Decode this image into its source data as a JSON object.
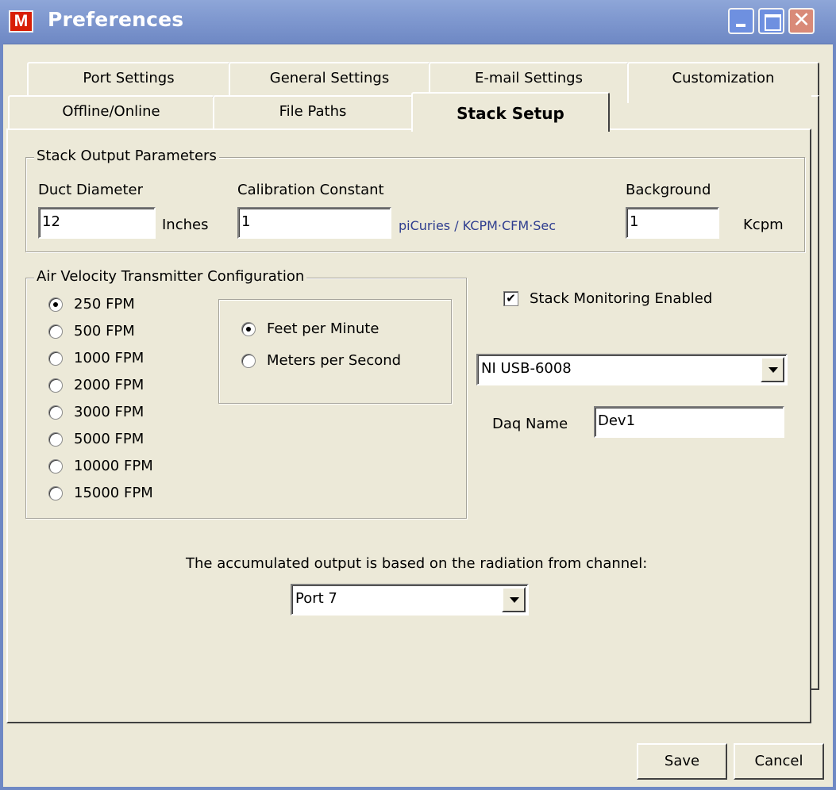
{
  "window": {
    "title": "Preferences",
    "icon_letter": "M",
    "close_glyph": "✕"
  },
  "tabs_back": [
    "Port Settings",
    "General Settings",
    "E-mail Settings",
    "Customization"
  ],
  "tabs_front": [
    "Offline/Online",
    "File Paths",
    "Stack Setup"
  ],
  "active_tab": "Stack Setup",
  "stack_output": {
    "title": "Stack Output Parameters",
    "duct_label": "Duct Diameter",
    "duct_value": "12",
    "duct_unit": "Inches",
    "cal_label": "Calibration Constant",
    "cal_value": "1",
    "cal_unit": "piCuries / KCPM·CFM·Sec",
    "bg_label": "Background",
    "bg_value": "1",
    "bg_unit": "Kcpm"
  },
  "air_velocity": {
    "title": "Air Velocity Transmitter Configuration",
    "options": [
      "250 FPM",
      "500 FPM",
      "1000 FPM",
      "2000 FPM",
      "3000 FPM",
      "5000 FPM",
      "10000 FPM",
      "15000 FPM"
    ],
    "selected": "250 FPM",
    "units": [
      "Feet per Minute",
      "Meters per Second"
    ],
    "selected_unit": "Feet per Minute"
  },
  "monitoring": {
    "checkbox_label": "Stack Monitoring Enabled",
    "checked": true,
    "device": "NI USB-6008",
    "daq_label": "Daq Name",
    "daq_value": "Dev1"
  },
  "channel": {
    "label": "The accumulated output is based on the radiation from channel:",
    "value": "Port 7"
  },
  "buttons": {
    "save": "Save",
    "cancel": "Cancel"
  }
}
